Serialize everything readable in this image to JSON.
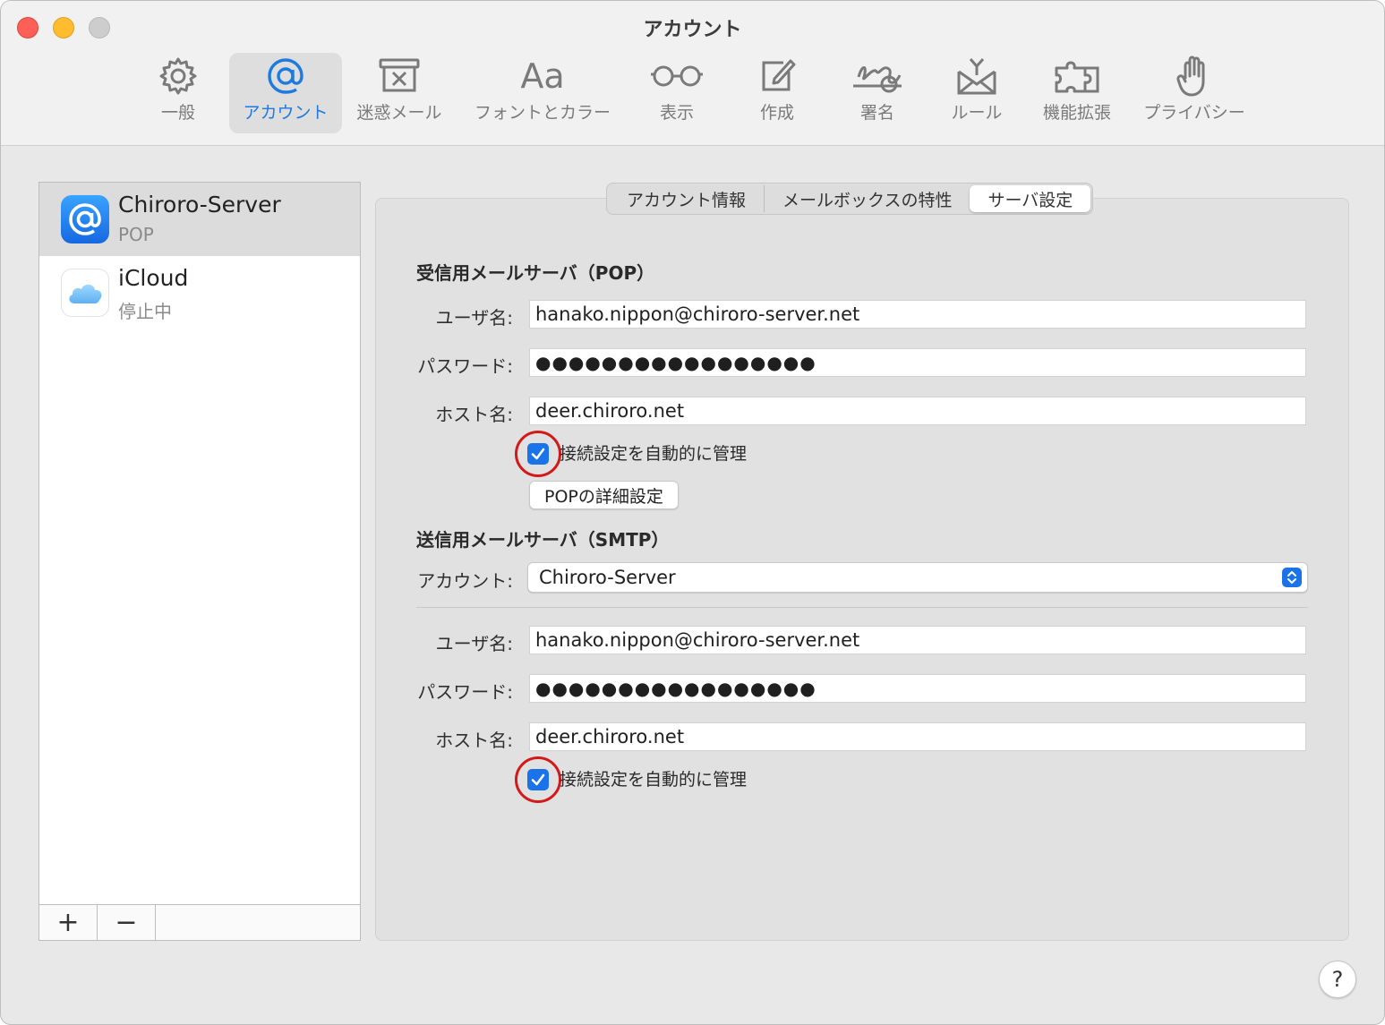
{
  "window": {
    "title": "アカウント"
  },
  "toolbar": {
    "items": [
      {
        "label": "一般",
        "icon": "gear-icon"
      },
      {
        "label": "アカウント",
        "icon": "at-sign-icon",
        "active": true
      },
      {
        "label": "迷惑メール",
        "icon": "junk-tray-icon"
      },
      {
        "label": "フォントとカラー",
        "icon": "font-icon"
      },
      {
        "label": "表示",
        "icon": "glasses-icon"
      },
      {
        "label": "作成",
        "icon": "compose-icon"
      },
      {
        "label": "署名",
        "icon": "signature-icon"
      },
      {
        "label": "ルール",
        "icon": "rules-envelope-icon"
      },
      {
        "label": "機能拡張",
        "icon": "puzzle-icon"
      },
      {
        "label": "プライバシー",
        "icon": "hand-icon"
      }
    ],
    "font_icon_text": "Aa"
  },
  "accounts": [
    {
      "name": "Chiroro-Server",
      "type": "POP",
      "icon": "at-sign-icon",
      "selected": true
    },
    {
      "name": "iCloud",
      "type": "停止中",
      "icon": "icloud-icon",
      "selected": false
    }
  ],
  "list_footer": {
    "add": "+",
    "remove": "−"
  },
  "tabs": [
    {
      "label": "アカウント情報"
    },
    {
      "label": "メールボックスの特性"
    },
    {
      "label": "サーバ設定",
      "active": true
    }
  ],
  "incoming": {
    "title": "受信用メールサーバ（POP）",
    "username_label": "ユーザ名:",
    "username": "hanako.nippon@chiroro-server.net",
    "password_label": "パスワード:",
    "password": "●●●●●●●●●●●●●●●●●",
    "host_label": "ホスト名:",
    "host": "deer.chiroro.net",
    "auto_manage_label": "接続設定を自動的に管理",
    "auto_manage": true,
    "advanced_button": "POPの詳細設定"
  },
  "outgoing": {
    "title": "送信用メールサーバ（SMTP）",
    "account_label": "アカウント:",
    "account": "Chiroro-Server",
    "username_label": "ユーザ名:",
    "username": "hanako.nippon@chiroro-server.net",
    "password_label": "パスワード:",
    "password": "●●●●●●●●●●●●●●●●●",
    "host_label": "ホスト名:",
    "host": "deer.chiroro.net",
    "auto_manage_label": "接続設定を自動的に管理",
    "auto_manage": true
  },
  "help": {
    "label": "?"
  },
  "colors": {
    "accent": "#1a73e8",
    "annotation_ring": "#d21a1a"
  }
}
